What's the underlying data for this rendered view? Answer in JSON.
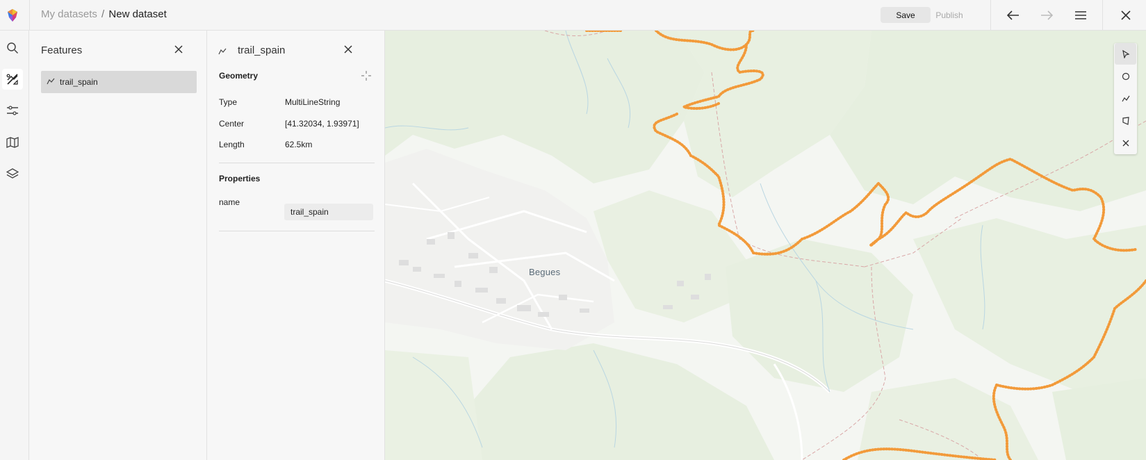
{
  "header": {
    "breadcrumb_parent": "My datasets",
    "breadcrumb_separator": "/",
    "breadcrumb_current": "New dataset",
    "save_label": "Save",
    "publish_label": "Publish"
  },
  "features_panel": {
    "title": "Features",
    "items": [
      {
        "label": "trail_spain",
        "icon": "line-string-icon"
      }
    ]
  },
  "detail_panel": {
    "title": "trail_spain",
    "geometry_title": "Geometry",
    "geometry": [
      {
        "key": "Type",
        "value": "MultiLineString"
      },
      {
        "key": "Center",
        "value": "[41.32034, 1.93971]"
      },
      {
        "key": "Length",
        "value": "62.5km"
      }
    ],
    "properties_title": "Properties",
    "properties": [
      {
        "key": "name",
        "value": "trail_spain"
      }
    ]
  },
  "map": {
    "place_label": "Begues",
    "trail_color": "#f29a3a"
  },
  "draw_tools": [
    "pointer-icon",
    "circle-icon",
    "line-icon",
    "polygon-icon",
    "close-icon"
  ],
  "colors": {
    "accent_trail": "#f29a3a",
    "forest": "#e6efdf",
    "urban": "#f0f0ee"
  }
}
